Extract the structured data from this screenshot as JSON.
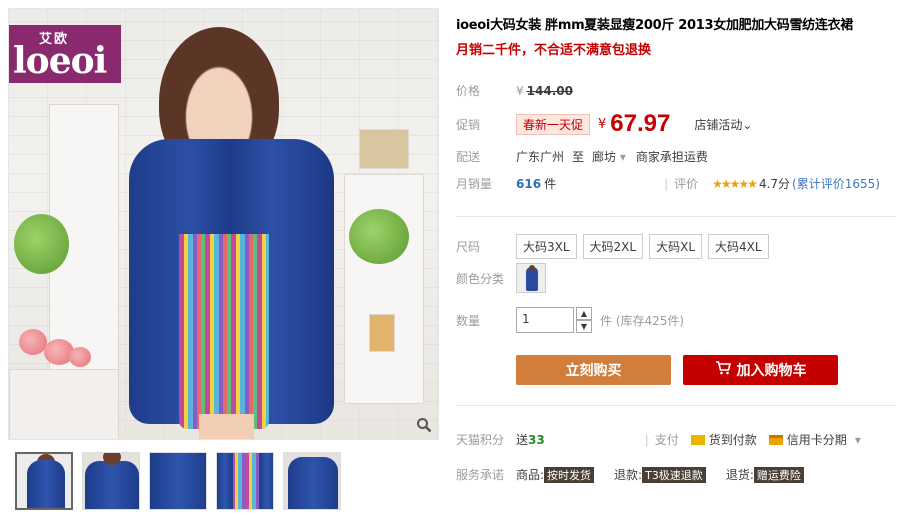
{
  "brand": {
    "cn": "艾欧",
    "en": "loeoi"
  },
  "product": {
    "title": "ioeoi大码女装 胖mm夏装显瘦200斤 2013女加肥加大码雪纺连衣裙",
    "subtitle": "月销二千件，不合适不满意包退换"
  },
  "price": {
    "label": "价格",
    "currency": "¥",
    "original": "144.00"
  },
  "promo": {
    "label": "促销",
    "tag": "春新一天促",
    "currency": "¥",
    "price": "67.97",
    "store_activity": "店铺活动",
    "store_activity_caret": "⌄"
  },
  "shipping": {
    "label": "配送",
    "from": "广东广州",
    "to_word": "至",
    "to": "廊坊",
    "caret": "▾",
    "fee": "商家承担运费"
  },
  "sales": {
    "label": "月销量",
    "count": "616",
    "unit": "件",
    "rating_label": "评价",
    "stars": "★★★★★",
    "rating": "4.7分",
    "review_count": "(累计评价1655)"
  },
  "sizes": {
    "label": "尺码",
    "options": [
      "大码3XL",
      "大码2XL",
      "大码XL",
      "大码4XL"
    ]
  },
  "color": {
    "label": "颜色分类"
  },
  "quantity": {
    "label": "数量",
    "value": "1",
    "up": "▲",
    "down": "▼",
    "stock": "件 (库存425件)"
  },
  "actions": {
    "buy_now": "立刻购买",
    "add_to_cart": "加入购物车"
  },
  "points": {
    "label": "天猫积分",
    "text": "送",
    "value": "33"
  },
  "payment": {
    "label": "支付",
    "cod": "货到付款",
    "credit": "信用卡分期",
    "caret": "▾"
  },
  "service": {
    "label": "服务承诺",
    "item1_prefix": "商品:",
    "item1_tag": "按时发货",
    "item2_prefix": "退款:",
    "item2_tag": "T3极速退款",
    "item3_prefix": "退货:",
    "item3_tag": "赠运费险"
  },
  "colors": {
    "accent_red": "#c40000",
    "buy_orange": "#d17d3c",
    "brand_purple": "#8a2a6e"
  }
}
